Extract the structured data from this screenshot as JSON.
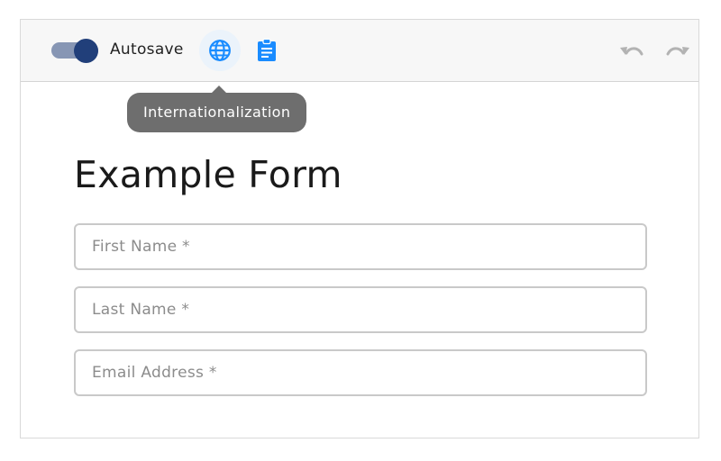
{
  "toolbar": {
    "autosave": {
      "label": "Autosave",
      "enabled": true
    },
    "icons": {
      "globe": "globe-icon",
      "clipboard": "clipboard-icon",
      "undo": "undo-icon",
      "redo": "redo-icon"
    },
    "tooltip": "Internationalization"
  },
  "form": {
    "title": "Example Form",
    "fields": [
      {
        "placeholder": "First Name *"
      },
      {
        "placeholder": "Last Name *"
      },
      {
        "placeholder": "Email Address *"
      }
    ]
  },
  "colors": {
    "accent": "#1a8cff",
    "toggle_track": "#8796b4",
    "toggle_knob": "#213f7a",
    "tooltip_bg": "#6e6e6e",
    "disabled_icon": "#b3b3b3"
  }
}
